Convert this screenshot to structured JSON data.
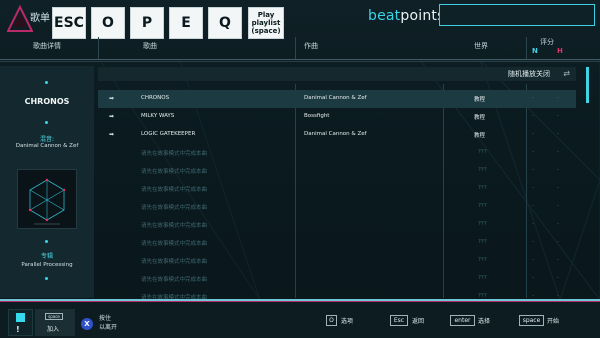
{
  "topbar": {
    "playlist_label": "歌单",
    "keys": [
      "ESC",
      "O",
      "P",
      "E",
      "Q"
    ],
    "play_playlist_lines": [
      "Play",
      "playlist",
      "(space)"
    ],
    "brand_part1": "beat",
    "brand_part2": "points",
    "search_value": ""
  },
  "header": {
    "song_details": "歌曲详情",
    "song": "歌曲",
    "composer": "作曲",
    "world": "世界",
    "rating": "评分",
    "rating_n": "N",
    "rating_h": "H"
  },
  "details": {
    "title": "CHRONOS",
    "difficulty_label": "混音:",
    "artist": "Danimal Cannon & Zef",
    "album_label": "专辑",
    "album_name": "Parallel Processing"
  },
  "table": {
    "shuffle_label": "随机播放关闭",
    "rows": [
      {
        "song": "CHRONOS",
        "composer": "Danimal Cannon & Zef",
        "world": "教程",
        "n": "-",
        "h": "-",
        "selected": true,
        "locked": false
      },
      {
        "song": "MILKY WAYS",
        "composer": "Bossfight",
        "world": "教程",
        "n": "-",
        "h": "-",
        "selected": false,
        "locked": false
      },
      {
        "song": "LOGIC GATEKEEPER",
        "composer": "Danimal Cannon & Zef",
        "world": "教程",
        "n": "-",
        "h": "-",
        "selected": false,
        "locked": false
      },
      {
        "song": "请先在故事模式中完成本曲",
        "composer": "",
        "world": "???",
        "n": "-",
        "h": "-",
        "selected": false,
        "locked": true
      },
      {
        "song": "请先在故事模式中完成本曲",
        "composer": "",
        "world": "???",
        "n": "-",
        "h": "-",
        "selected": false,
        "locked": true
      },
      {
        "song": "请先在故事模式中完成本曲",
        "composer": "",
        "world": "???",
        "n": "-",
        "h": "-",
        "selected": false,
        "locked": true
      },
      {
        "song": "请先在故事模式中完成本曲",
        "composer": "",
        "world": "???",
        "n": "-",
        "h": "-",
        "selected": false,
        "locked": true
      },
      {
        "song": "请先在故事模式中完成本曲",
        "composer": "",
        "world": "???",
        "n": "-",
        "h": "-",
        "selected": false,
        "locked": true
      },
      {
        "song": "请先在故事模式中完成本曲",
        "composer": "",
        "world": "???",
        "n": "-",
        "h": "-",
        "selected": false,
        "locked": true
      },
      {
        "song": "请先在故事模式中完成本曲",
        "composer": "",
        "world": "???",
        "n": "-",
        "h": "-",
        "selected": false,
        "locked": true
      },
      {
        "song": "请先在故事模式中完成本曲",
        "composer": "",
        "world": "???",
        "n": "-",
        "h": "-",
        "selected": false,
        "locked": true
      },
      {
        "song": "请先在故事模式中完成本曲",
        "composer": "",
        "world": "???",
        "n": "-",
        "h": "-",
        "selected": false,
        "locked": true
      }
    ]
  },
  "bottom": {
    "join_key": "space",
    "join_label": "加入",
    "x_button": "X",
    "hold_line1": "按住",
    "hold_line2": "以离开",
    "hints": [
      {
        "key": "O",
        "label": "选项"
      },
      {
        "key": "Esc",
        "label": "返回"
      },
      {
        "key": "enter",
        "label": "选择"
      },
      {
        "key": "space",
        "label": "开始"
      }
    ]
  },
  "colors": {
    "accent": "#3fd3e3",
    "rating_n": "#3fd3e3",
    "rating_h": "#e0306a",
    "background": "#0b1a1f"
  }
}
